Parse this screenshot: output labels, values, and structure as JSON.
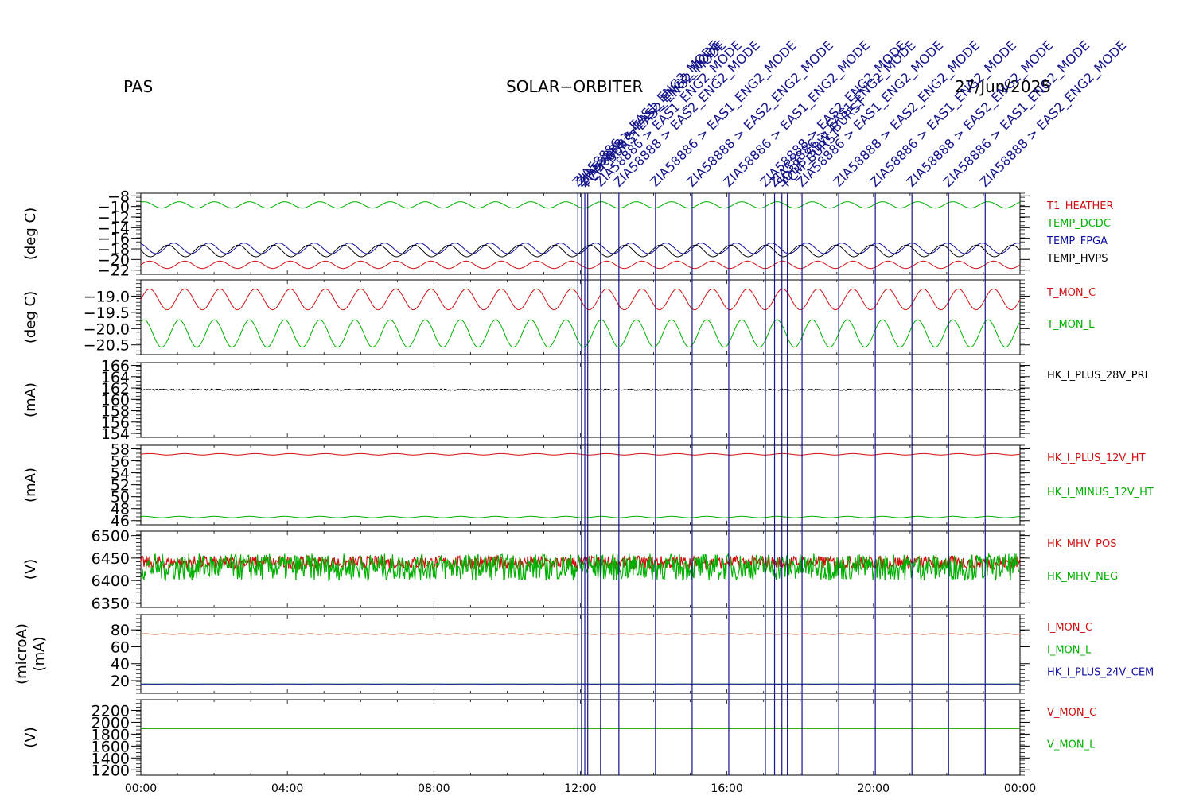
{
  "header": {
    "instrument": "PAS",
    "mission": "SOLAR−ORBITER",
    "date": "27/Jun/2025"
  },
  "colors": {
    "red": "#d01010",
    "green": "#00b000",
    "blue": "#1010a0",
    "black": "#000000",
    "event_line": "#14148c"
  },
  "chart_data": {
    "type": "line",
    "x_ticks": [
      "00:00",
      "04:00",
      "08:00",
      "12:00",
      "16:00",
      "20:00",
      "00:00"
    ],
    "x_range_hours": [
      0,
      24
    ],
    "events": [
      {
        "t": 11.93,
        "label": "ZIA58886 > EAS1_ENG2_MODE"
      },
      {
        "t": 12.03,
        "label": "ZIA58888 > EAS2_ENG2_MODE"
      },
      {
        "t": 12.12,
        "label": "ZIA58888 > EAS2_ENG2_MODE"
      },
      {
        "t": 12.2,
        "label": "PCM_BURST"
      },
      {
        "t": 12.55,
        "label": "ZIA58886 > EAS1_ENG2_MODE"
      },
      {
        "t": 13.05,
        "label": "ZIA58888 > EAS2_ENG2_MODE"
      },
      {
        "t": 14.05,
        "label": "ZIA58886 > EAS1_ENG2_MODE"
      },
      {
        "t": 15.05,
        "label": "ZIA58888 > EAS2_ENG2_MODE"
      },
      {
        "t": 16.05,
        "label": "ZIA58886 > EAS1_ENG2_MODE"
      },
      {
        "t": 17.05,
        "label": "ZIA58888 > EAS2_ENG2_MODE"
      },
      {
        "t": 17.3,
        "label": "ZIA58886 > EAS1_ENG2_MODE"
      },
      {
        "t": 17.5,
        "label": "SDDS_SBW_BURST"
      },
      {
        "t": 17.65,
        "label": "PCM_BURST"
      },
      {
        "t": 18.05,
        "label": "ZIA58886 > EAS1_ENG2_MODE"
      },
      {
        "t": 19.05,
        "label": "ZIA58888 > EAS2_ENG2_MODE"
      },
      {
        "t": 20.05,
        "label": "ZIA58886 > EAS1_ENG2_MODE"
      },
      {
        "t": 21.05,
        "label": "ZIA58888 > EAS2_ENG2_MODE"
      },
      {
        "t": 22.05,
        "label": "ZIA58886 > EAS1_ENG2_MODE"
      },
      {
        "t": 23.05,
        "label": "ZIA58888 > EAS2_ENG2_MODE"
      }
    ],
    "panels": [
      {
        "ylabel": "(deg C)",
        "ylim": [
          -22.8,
          -7.5
        ],
        "yticks": [
          -8,
          -10,
          -12,
          -14,
          -16,
          -18,
          -20,
          -22
        ],
        "ytick_labels": [
          "−8",
          "−10",
          "−12",
          "−14",
          "−16",
          "−18",
          "−20",
          "−22"
        ],
        "series": [
          {
            "name": "T1_HEATHER",
            "color": "red",
            "base": -21.0,
            "amp": 0.7,
            "period_h": 0.96
          },
          {
            "name": "TEMP_DCDC",
            "color": "green",
            "base": -9.7,
            "amp": 0.6,
            "period_h": 0.96
          },
          {
            "name": "TEMP_FPGA",
            "color": "blue",
            "base": -17.9,
            "amp": 1.0,
            "period_h": 0.96
          },
          {
            "name": "TEMP_HVPS",
            "color": "black",
            "base": -18.4,
            "amp": 1.1,
            "period_h": 0.96
          }
        ]
      },
      {
        "ylabel": "(deg C)",
        "ylim": [
          -20.8,
          -18.5
        ],
        "yticks": [
          -19.0,
          -19.5,
          -20.0,
          -20.5
        ],
        "ytick_labels": [
          "−19.0",
          "−19.5",
          "−20.0",
          "−20.5"
        ],
        "series": [
          {
            "name": "T_MON_C",
            "color": "red",
            "base": -19.1,
            "amp": 0.32,
            "period_h": 0.96
          },
          {
            "name": "T_MON_L",
            "color": "green",
            "base": -20.15,
            "amp": 0.42,
            "period_h": 0.96
          }
        ]
      },
      {
        "ylabel": "(mA)",
        "ylim": [
          153.3,
          166.5
        ],
        "yticks": [
          154,
          156,
          158,
          160,
          162,
          164,
          166
        ],
        "ytick_labels": [
          "154",
          "156",
          "158",
          "160",
          "162",
          "164",
          "166"
        ],
        "series": [
          {
            "name": "HK_I_PLUS_28V_PRI",
            "color": "black",
            "base": 161.7,
            "amp": 0.05,
            "period_h": 0.1
          }
        ]
      },
      {
        "ylabel": "(mA)",
        "ylim": [
          45.3,
          58.6
        ],
        "yticks": [
          46,
          48,
          50,
          52,
          54,
          56,
          58
        ],
        "ytick_labels": [
          "46",
          "48",
          "50",
          "52",
          "54",
          "56",
          "58"
        ],
        "series": [
          {
            "name": "HK_I_PLUS_12V_HT",
            "color": "red",
            "base": 57.1,
            "amp": 0.12,
            "period_h": 0.96
          },
          {
            "name": "HK_I_MINUS_12V_HT",
            "color": "green",
            "base": 46.6,
            "amp": 0.12,
            "period_h": 0.96
          }
        ]
      },
      {
        "ylabel": "(V)",
        "ylim": [
          6340,
          6510
        ],
        "yticks": [
          6350,
          6400,
          6450,
          6500
        ],
        "ytick_labels": [
          "6350",
          "6400",
          "6450",
          "6500"
        ],
        "series": [
          {
            "name": "HK_MHV_POS",
            "color": "red",
            "base": 6440,
            "amp": 15,
            "period_h": 0.05
          },
          {
            "name": "HK_MHV_NEG",
            "color": "green",
            "base": 6430,
            "amp": 30,
            "period_h": 0.05
          }
        ]
      },
      {
        "ylabel": "(microA)\n(mA)",
        "ylim": [
          5,
          98
        ],
        "yticks": [
          20,
          40,
          60,
          80
        ],
        "ytick_labels": [
          "20",
          "40",
          "60",
          "80"
        ],
        "series": [
          {
            "name": "I_MON_C",
            "color": "red",
            "base": 75,
            "amp": 0.4,
            "period_h": 0.5
          },
          {
            "name": "I_MON_L",
            "color": "green",
            "base": 16,
            "amp": 0.0,
            "period_h": 1
          },
          {
            "name": "HK_I_PLUS_24V_CEM",
            "color": "blue",
            "base": 16,
            "amp": 0.1,
            "period_h": 1
          }
        ]
      },
      {
        "ylabel": "(V)",
        "ylim": [
          1110,
          2380
        ],
        "yticks": [
          1200,
          1400,
          1600,
          1800,
          2000,
          2200
        ],
        "ytick_labels": [
          "1200",
          "1400",
          "1600",
          "1800",
          "2000",
          "2200"
        ],
        "series": [
          {
            "name": "V_MON_C",
            "color": "red",
            "base": 1895,
            "amp": 0,
            "period_h": 1
          },
          {
            "name": "V_MON_L",
            "color": "green",
            "base": 1895,
            "amp": 0,
            "period_h": 1
          }
        ]
      }
    ]
  }
}
